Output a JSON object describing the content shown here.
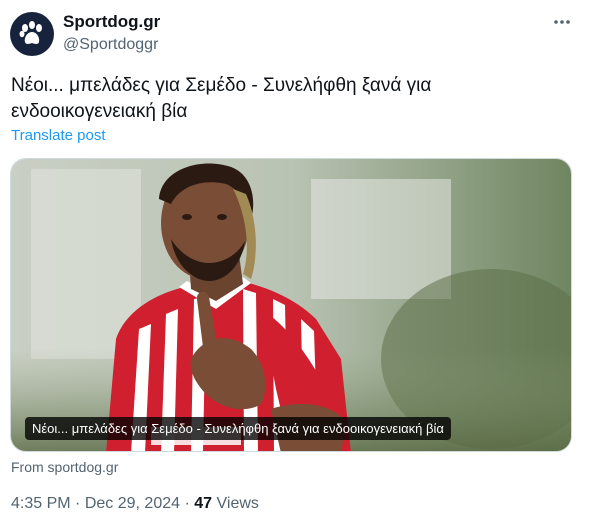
{
  "author": {
    "name": "Sportdog.gr",
    "handle": "@Sportdoggr",
    "avatar_icon": "paw-icon"
  },
  "post": {
    "text": "Νέοι... μπελάδες για Σεμέδο - Συνελήφθη ξανά για ενδοοικογενειακή βία",
    "translate_label": "Translate post"
  },
  "card": {
    "title": "Νέοι... μπελάδες για Σεμέδο - Συνελήφθη ξανά για ενδοοικογενειακή βία",
    "source": "From sportdog.gr"
  },
  "meta": {
    "time": "4:35 PM",
    "separator": "·",
    "date": "Dec 29, 2024",
    "views_count": "47",
    "views_label": "Views"
  },
  "colors": {
    "accent": "#1d9bf0",
    "secondary_text": "#536471",
    "jersey_red": "#d0202f"
  }
}
